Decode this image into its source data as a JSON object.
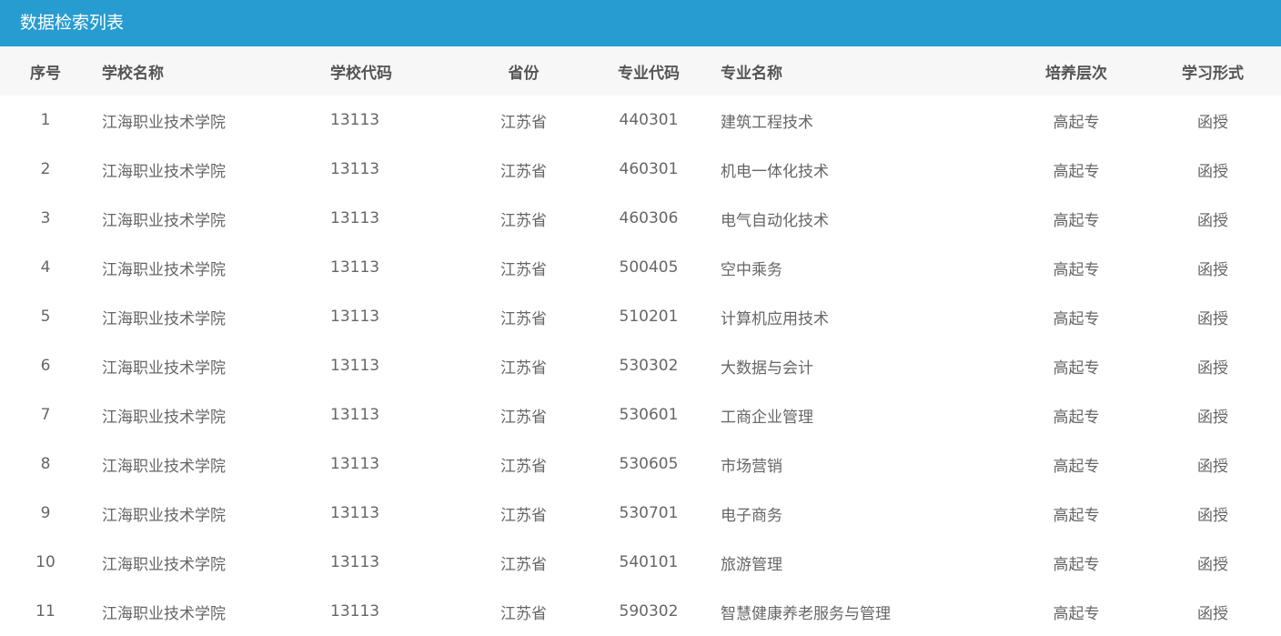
{
  "panel": {
    "title": "数据检索列表"
  },
  "table": {
    "headers": {
      "index": "序号",
      "school_name": "学校名称",
      "school_code": "学校代码",
      "province": "省份",
      "major_code": "专业代码",
      "major_name": "专业名称",
      "level": "培养层次",
      "study_mode": "学习形式"
    },
    "rows": [
      {
        "index": "1",
        "school_name": "江海职业技术学院",
        "school_code": "13113",
        "province": "江苏省",
        "major_code": "440301",
        "major_name": "建筑工程技术",
        "level": "高起专",
        "study_mode": "函授"
      },
      {
        "index": "2",
        "school_name": "江海职业技术学院",
        "school_code": "13113",
        "province": "江苏省",
        "major_code": "460301",
        "major_name": "机电一体化技术",
        "level": "高起专",
        "study_mode": "函授"
      },
      {
        "index": "3",
        "school_name": "江海职业技术学院",
        "school_code": "13113",
        "province": "江苏省",
        "major_code": "460306",
        "major_name": "电气自动化技术",
        "level": "高起专",
        "study_mode": "函授"
      },
      {
        "index": "4",
        "school_name": "江海职业技术学院",
        "school_code": "13113",
        "province": "江苏省",
        "major_code": "500405",
        "major_name": "空中乘务",
        "level": "高起专",
        "study_mode": "函授"
      },
      {
        "index": "5",
        "school_name": "江海职业技术学院",
        "school_code": "13113",
        "province": "江苏省",
        "major_code": "510201",
        "major_name": "计算机应用技术",
        "level": "高起专",
        "study_mode": "函授"
      },
      {
        "index": "6",
        "school_name": "江海职业技术学院",
        "school_code": "13113",
        "province": "江苏省",
        "major_code": "530302",
        "major_name": "大数据与会计",
        "level": "高起专",
        "study_mode": "函授"
      },
      {
        "index": "7",
        "school_name": "江海职业技术学院",
        "school_code": "13113",
        "province": "江苏省",
        "major_code": "530601",
        "major_name": "工商企业管理",
        "level": "高起专",
        "study_mode": "函授"
      },
      {
        "index": "8",
        "school_name": "江海职业技术学院",
        "school_code": "13113",
        "province": "江苏省",
        "major_code": "530605",
        "major_name": "市场营销",
        "level": "高起专",
        "study_mode": "函授"
      },
      {
        "index": "9",
        "school_name": "江海职业技术学院",
        "school_code": "13113",
        "province": "江苏省",
        "major_code": "530701",
        "major_name": "电子商务",
        "level": "高起专",
        "study_mode": "函授"
      },
      {
        "index": "10",
        "school_name": "江海职业技术学院",
        "school_code": "13113",
        "province": "江苏省",
        "major_code": "540101",
        "major_name": "旅游管理",
        "level": "高起专",
        "study_mode": "函授"
      },
      {
        "index": "11",
        "school_name": "江海职业技术学院",
        "school_code": "13113",
        "province": "江苏省",
        "major_code": "590302",
        "major_name": "智慧健康养老服务与管理",
        "level": "高起专",
        "study_mode": "函授"
      }
    ]
  },
  "colors": {
    "header_bar": "#279cd0",
    "table_header_bg": "#f7f7f7"
  }
}
